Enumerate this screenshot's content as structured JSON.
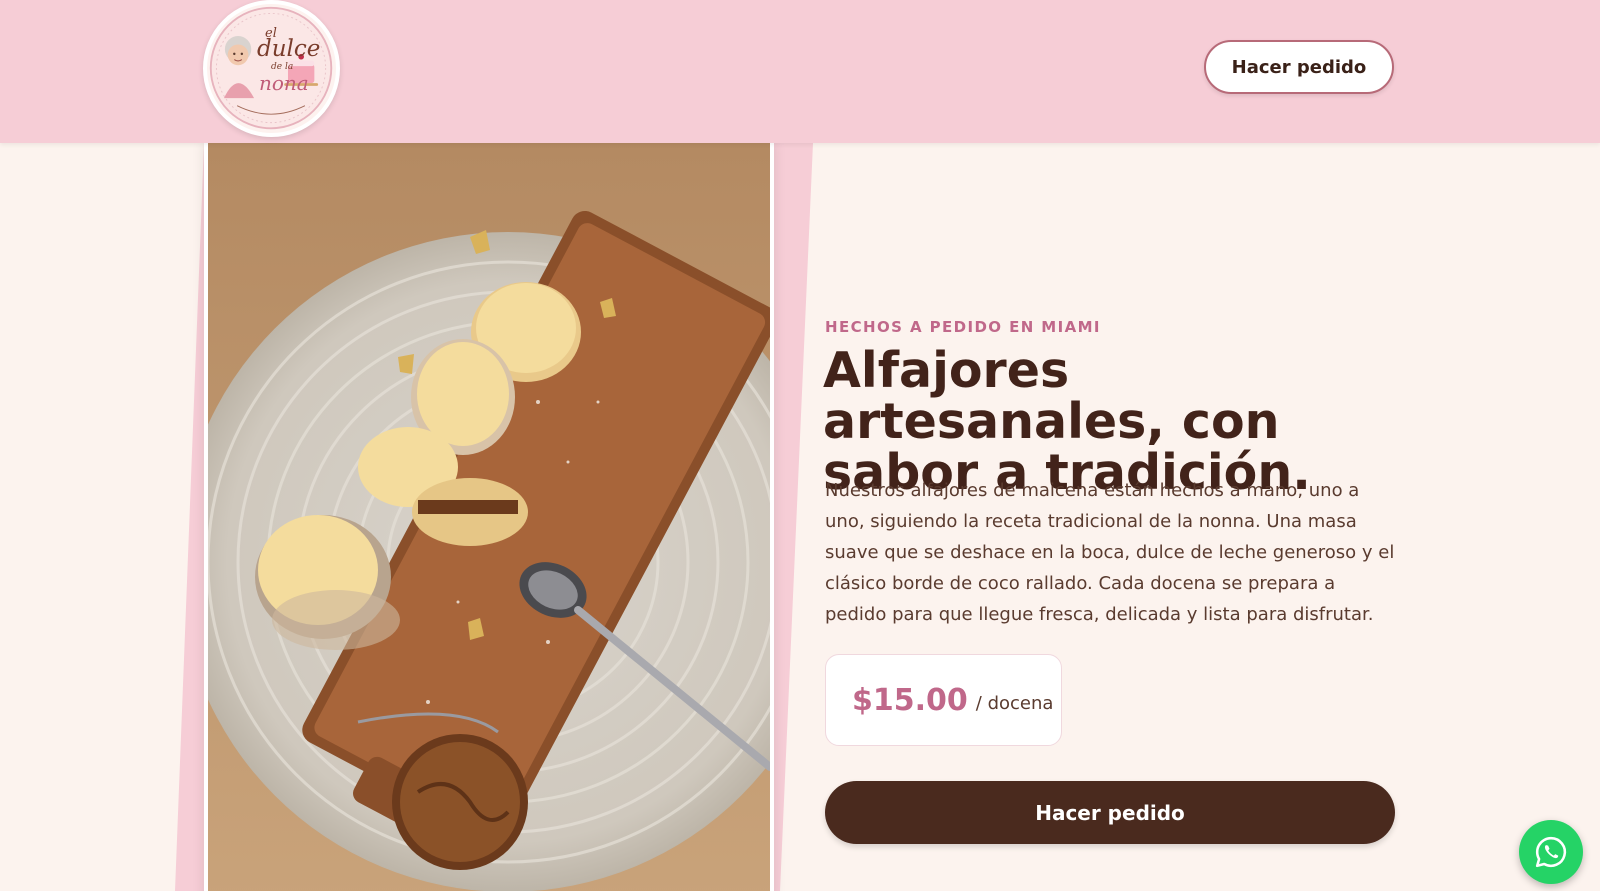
{
  "header": {
    "logo": {
      "icon": "grandma-bakery-logo",
      "line1": "el",
      "line2": "dulce",
      "line3": "de la",
      "line4": "nona"
    },
    "order_button": "Hacer pedido"
  },
  "hero": {
    "image_icon": "alfajores-photo",
    "eyebrow": "HECHOS A PEDIDO EN MIAMI",
    "title": "Alfajores artesanales, con sabor a tradición.",
    "description": "Nuestros alfajores de maicena están hechos a mano, uno a uno, siguiendo la receta tradicional de la nonna. Una masa suave que se deshace en la boca, dulce de leche generoso y el clásico borde de coco rallado. Cada docena se prepara a pedido para que llegue fresca, delicada y lista para disfrutar.",
    "price": "$15.00",
    "price_unit": "/ docena",
    "order_button": "Hacer pedido"
  },
  "floating": {
    "whatsapp_icon": "whatsapp-icon"
  },
  "colors": {
    "header_bg": "#f6cdd6",
    "page_bg": "#fcf3ee",
    "accent_pink": "#c0688a",
    "brown": "#4a2a1e",
    "whatsapp_green": "#25d366"
  }
}
